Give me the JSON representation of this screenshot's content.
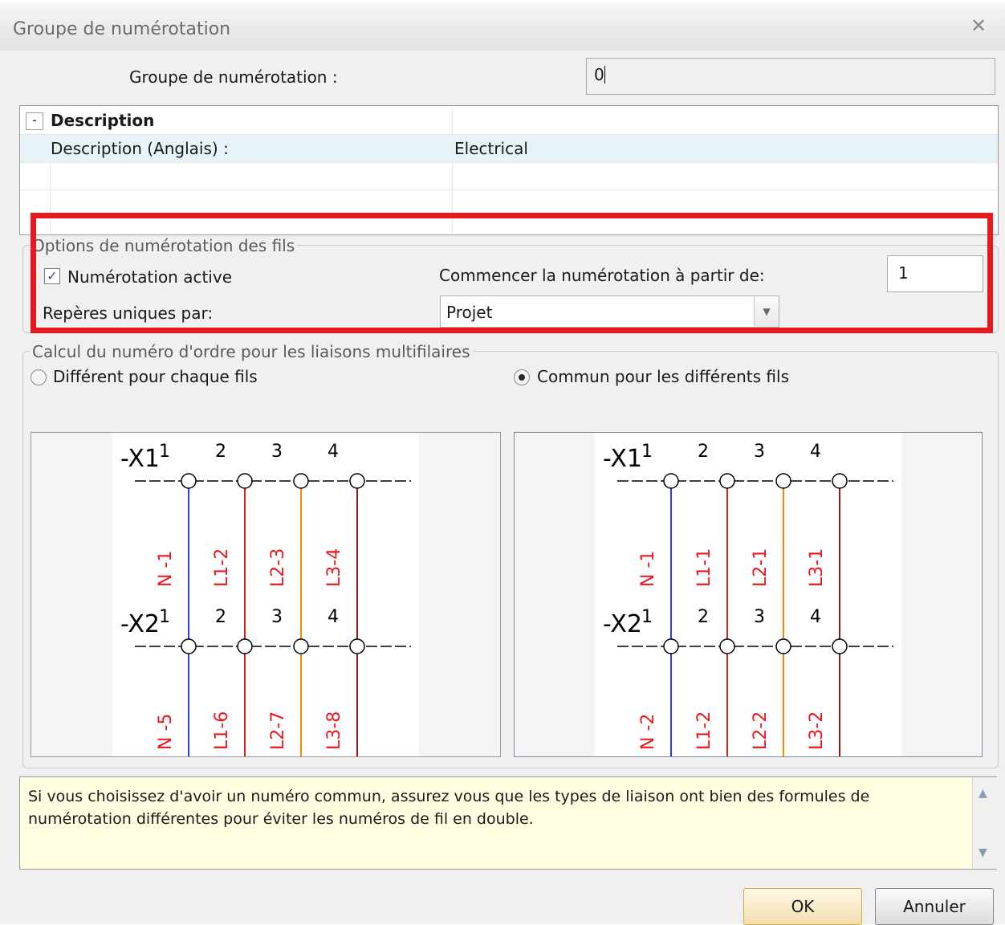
{
  "window": {
    "title": "Groupe de numérotation",
    "close_icon": "close-icon"
  },
  "group": {
    "label": "Groupe de numérotation :",
    "value": "0"
  },
  "grid": {
    "section": {
      "toggle": "-",
      "title": "Description"
    },
    "rows": [
      {
        "name": "Description (Anglais) :",
        "value": "Electrical"
      }
    ]
  },
  "wire_options": {
    "legend": "Options de numérotation des fils",
    "active_label": "Numérotation active",
    "active_checked": true,
    "start_label": "Commencer la numérotation à partir de:",
    "start_value": "1",
    "unique_label": "Repères uniques par:",
    "unique_value": "Projet"
  },
  "multi": {
    "legend": "Calcul du numéro d'ordre pour les liaisons multifilaires",
    "option_different": "Différent pour chaque fils",
    "option_common": "Commun pour les différents fils",
    "selected": "common"
  },
  "diagram_left": {
    "x1": "-X1",
    "x2": "-X2",
    "terminals": [
      "1",
      "2",
      "3",
      "4"
    ],
    "top_labels": [
      "N -1",
      "L1-2",
      "L2-3",
      "L3-4"
    ],
    "bottom_labels": [
      "N -5",
      "L1-6",
      "L2-7",
      "L3-8"
    ]
  },
  "diagram_right": {
    "x1": "-X1",
    "x2": "-X2",
    "terminals": [
      "1",
      "2",
      "3",
      "4"
    ],
    "top_labels": [
      "N -1",
      "L1-1",
      "L2-1",
      "L3-1"
    ],
    "bottom_labels": [
      "N -2",
      "L1-2",
      "L2-2",
      "L3-2"
    ]
  },
  "wire_colors": [
    "#2b3fe0",
    "#d82020",
    "#f08a00",
    "#8b1a1a"
  ],
  "label_color": "#e8181f",
  "info": "Si vous choisissez d'avoir un numéro commun, assurez vous que les types de liaison ont bien des formules de numérotation différentes pour éviter les numéros de fil en double.",
  "buttons": {
    "ok": "OK",
    "cancel": "Annuler"
  }
}
